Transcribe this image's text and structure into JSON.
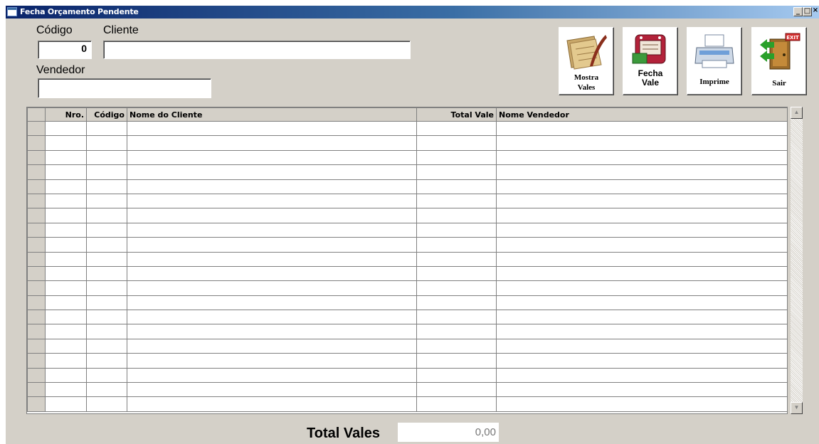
{
  "window": {
    "title": "Fecha Orçamento Pendente",
    "controls": {
      "minimize": "_",
      "maximize": "□",
      "close": "×"
    }
  },
  "form": {
    "codigo_label": "Código",
    "codigo_value": "0",
    "cliente_label": "Cliente",
    "cliente_value": "",
    "vendedor_label": "Vendedor",
    "vendedor_value": ""
  },
  "toolbar": {
    "mostra_vales": {
      "line1": "Mostra",
      "line2": "Vales",
      "icon": "papers-quill-icon"
    },
    "fecha_vale": {
      "line1": "Fecha",
      "line2": "Vale",
      "icon": "receipt-book-icon"
    },
    "imprime": {
      "label": "Imprime",
      "icon": "printer-icon"
    },
    "sair": {
      "label": "Sair",
      "icon": "exit-door-icon",
      "sign": "EXIT"
    }
  },
  "grid": {
    "columns": [
      "Nro.",
      "Código",
      "Nome do Cliente",
      "Total Vale",
      "Nome Vendedor"
    ],
    "empty_rows": 20
  },
  "footer": {
    "total_label": "Total Vales",
    "total_value": "0,00"
  },
  "colors": {
    "face": "#d4d0c8",
    "title_start": "#0a246a",
    "title_end": "#a6caf0"
  }
}
